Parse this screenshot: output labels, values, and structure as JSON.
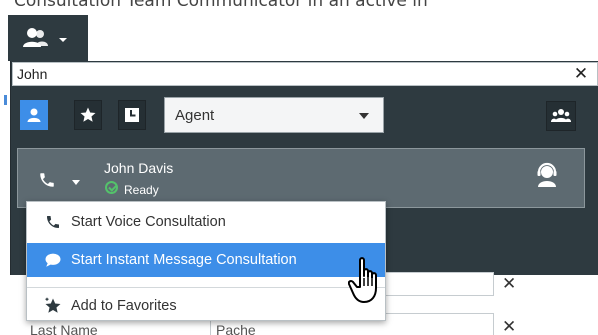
{
  "caption": "Consultation Team Communicator in an active in",
  "team_button": {
    "icon": "team-communicator-icon",
    "caret": "chevron-down-icon"
  },
  "search": {
    "value": "John",
    "placeholder": "",
    "clear_icon": "close-icon",
    "clear_glyph": "✕"
  },
  "filters": {
    "all": {
      "icon": "person-icon",
      "active": true
    },
    "favorites": {
      "icon": "star-icon"
    },
    "recent": {
      "icon": "clock-icon"
    }
  },
  "type_select": {
    "selected": "Agent"
  },
  "team_view": {
    "icon": "group-icon"
  },
  "result": {
    "name": "John Davis",
    "status": "Ready",
    "status_color": "#54c26b",
    "action_icon": "phone-icon",
    "type_icon": "agent-headset-icon"
  },
  "menu": {
    "items": [
      {
        "label": "Start Voice Consultation",
        "icon": "phone-icon"
      },
      {
        "label": "Start Instant Message Consultation",
        "icon": "chat-icon",
        "highlighted": true
      },
      {
        "label": "Add to Favorites",
        "icon": "star-add-icon"
      }
    ]
  },
  "background_form": {
    "row1_clear": "✕",
    "row2_clear": "✕",
    "label": "Last Name",
    "value": "Pache"
  },
  "colors": {
    "panel": "#2e3a40",
    "accent": "#3d8ee8",
    "row": "#5d6a71"
  }
}
